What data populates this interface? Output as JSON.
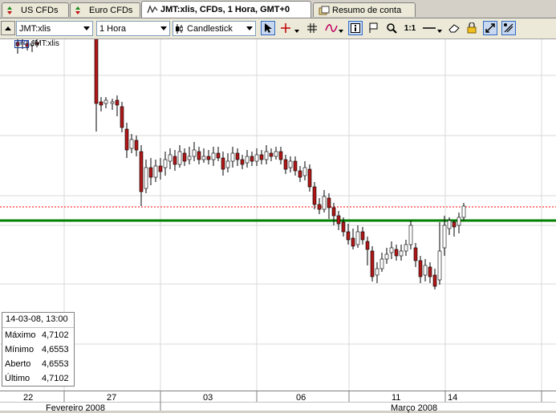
{
  "tabs": [
    {
      "label": "US CFDs",
      "icon": "updown-arrows-icon"
    },
    {
      "label": "Euro CFDs",
      "icon": "updown-arrows-icon"
    },
    {
      "label": "JMT:xlis, CFDs, 1 Hora, GMT+0",
      "icon": "chart-wave-icon"
    },
    {
      "label": "Resumo de conta",
      "icon": "account-summary-icon"
    }
  ],
  "toolbar": {
    "instrument": "JMT:xlis",
    "timeframe": "1 Hora",
    "chart_type": "Candlestick",
    "zoom_ratio": "1:1"
  },
  "chart": {
    "legend_label": "JMT:xlis",
    "cfd_badge": "CFD",
    "colors": {
      "up": "#ffffff",
      "down": "#b01818",
      "support": "#008000",
      "resistance": "#ff0000"
    },
    "x_ticks": [
      "22",
      "27",
      "03",
      "06",
      "11",
      "14"
    ],
    "months": [
      "Fevereiro 2008",
      "Março 2008"
    ]
  },
  "info": {
    "timestamp": "14-03-08, 13:00",
    "rows": [
      {
        "k": "Máximo",
        "v": "4,7102"
      },
      {
        "k": "Mínimo",
        "v": "4,6553"
      },
      {
        "k": "Aberto",
        "v": "4,6553"
      },
      {
        "k": "Último",
        "v": "4,7102"
      }
    ]
  }
}
